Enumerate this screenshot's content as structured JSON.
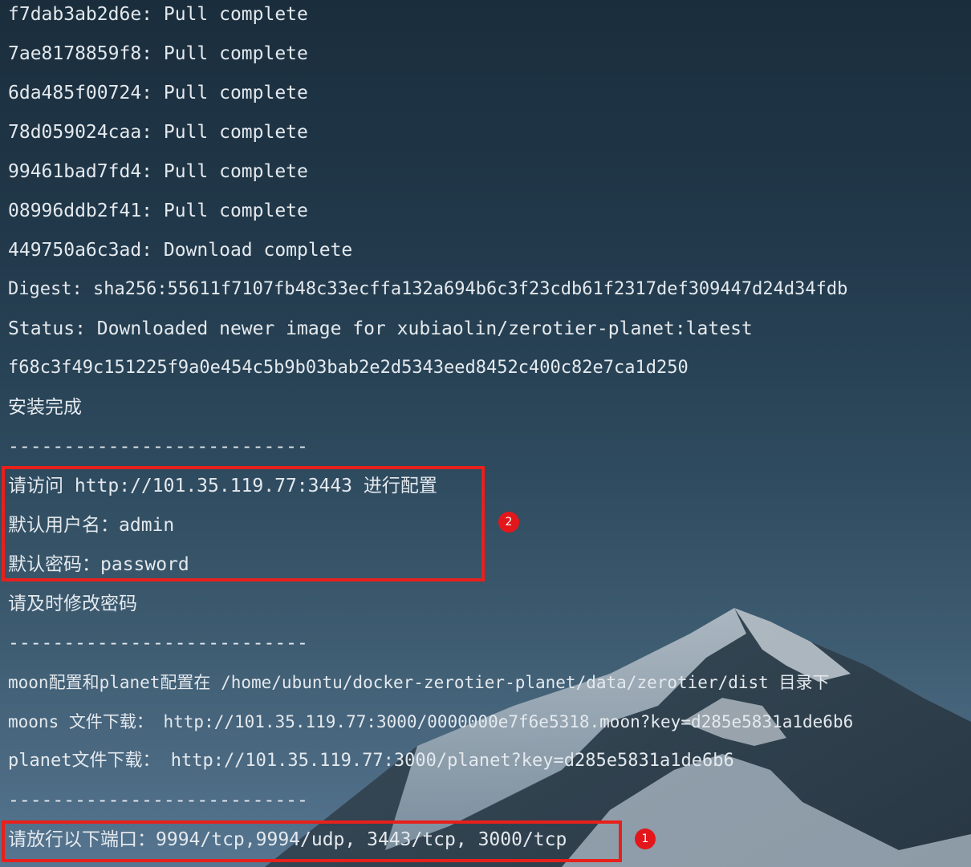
{
  "terminal": {
    "lines": [
      "f7dab3ab2d6e: Pull complete",
      "7ae8178859f8: Pull complete",
      "6da485f00724: Pull complete",
      "78d059024caa: Pull complete",
      "99461bad7fd4: Pull complete",
      "08996ddb2f41: Pull complete",
      "449750a6c3ad: Download complete",
      "Digest: sha256:55611f7107fb48c33ecffa132a694b6c3f23cdb61f2317def309447d24d34fdb",
      "Status: Downloaded newer image for xubiaolin/zerotier-planet:latest",
      "f68c3f49c151225f9a0e454c5b9b03bab2e2d5343eed8452c400c82e7ca1d250",
      "安装完成",
      "---------------------------",
      "请访问 http://101.35.119.77:3443 进行配置",
      "默认用户名：admin",
      "默认密码：password",
      "请及时修改密码",
      "---------------------------",
      "moon配置和planet配置在 /home/ubuntu/docker-zerotier-planet/data/zerotier/dist 目录下",
      "moons 文件下载： http://101.35.119.77:3000/0000000e7f6e5318.moon?key=d285e5831a1de6b6",
      "planet文件下载： http://101.35.119.77:3000/planet?key=d285e5831a1de6b6",
      "---------------------------",
      "请放行以下端口：9994/tcp,9994/udp, 3443/tcp, 3000/tcp"
    ]
  },
  "annotations": {
    "badge_1": "1",
    "badge_2": "2",
    "highlight_color": "#e8201c"
  }
}
